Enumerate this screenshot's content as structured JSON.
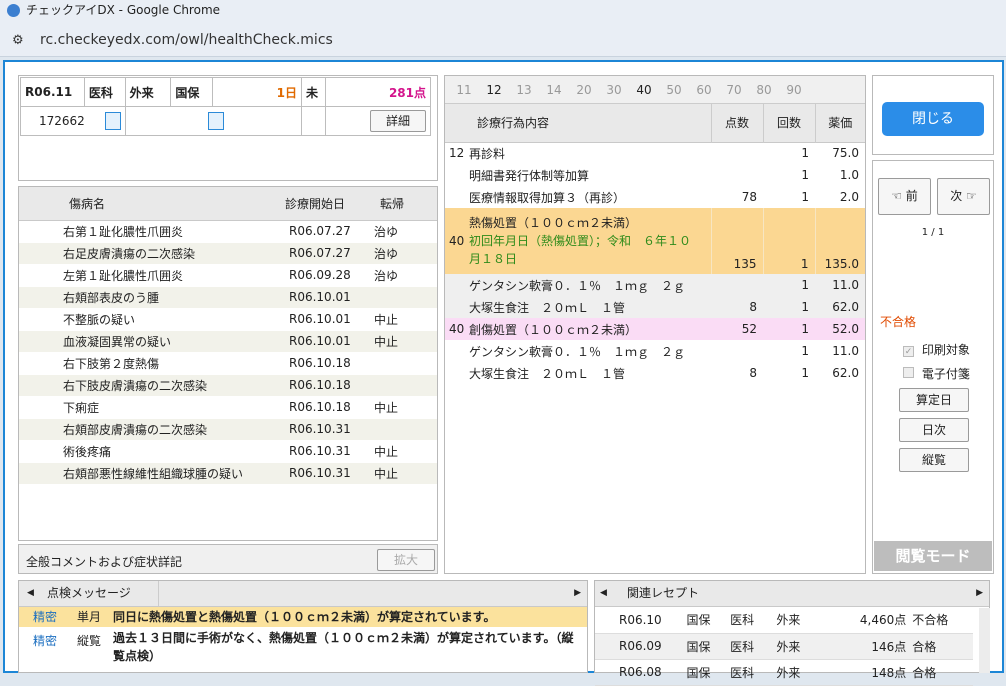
{
  "window": {
    "title": "チェックアイDX - Google Chrome",
    "url": "rc.checkeyedx.com/owl/healthCheck.mics"
  },
  "header": {
    "era": "R06.11",
    "dept": "医科",
    "visit": "外来",
    "ins": "国保",
    "days": "1日",
    "end": "未",
    "points": "281点",
    "patient_id": "172662",
    "detail_btn": "詳細"
  },
  "disease": {
    "col_name": "傷病名",
    "col_start": "診療開始日",
    "col_result": "転帰",
    "rows": [
      {
        "name": "右第１趾化膿性爪囲炎",
        "date": "R06.07.27",
        "result": "治ゆ"
      },
      {
        "name": "右足皮膚潰瘍の二次感染",
        "date": "R06.07.27",
        "result": "治ゆ"
      },
      {
        "name": "左第１趾化膿性爪囲炎",
        "date": "R06.09.28",
        "result": "治ゆ"
      },
      {
        "name": "右頬部表皮のう腫",
        "date": "R06.10.01",
        "result": ""
      },
      {
        "name": "不整脈の疑い",
        "date": "R06.10.01",
        "result": "中止"
      },
      {
        "name": "血液凝固異常の疑い",
        "date": "R06.10.01",
        "result": "中止"
      },
      {
        "name": "右下肢第２度熱傷",
        "date": "R06.10.18",
        "result": ""
      },
      {
        "name": "右下肢皮膚潰瘍の二次感染",
        "date": "R06.10.18",
        "result": ""
      },
      {
        "name": "下痢症",
        "date": "R06.10.18",
        "result": "中止"
      },
      {
        "name": "右頬部皮膚潰瘍の二次感染",
        "date": "R06.10.31",
        "result": ""
      },
      {
        "name": "術後疼痛",
        "date": "R06.10.31",
        "result": "中止"
      },
      {
        "name": "右頬部悪性線維性組織球腫の疑い",
        "date": "R06.10.31",
        "result": "中止"
      }
    ]
  },
  "comment": {
    "label": "全般コメントおよび症状詳記",
    "expand_btn": "拡大"
  },
  "tabs": [
    "11",
    "12",
    "13",
    "14",
    "20",
    "30",
    "40",
    "50",
    "60",
    "70",
    "80",
    "90"
  ],
  "treat": {
    "col_content": "診療行為内容",
    "col_points": "点数",
    "col_count": "回数",
    "col_price": "薬価",
    "rows": [
      {
        "code": "12",
        "content": "再診料",
        "points": "",
        "count": "1",
        "price": "75.0",
        "hl": ""
      },
      {
        "code": "",
        "content": "明細書発行体制等加算",
        "points": "",
        "count": "1",
        "price": "1.0",
        "hl": ""
      },
      {
        "code": "",
        "content": "医療情報取得加算３（再診）",
        "points": "78",
        "count": "1",
        "price": "2.0",
        "hl": ""
      },
      {
        "code": "",
        "content": "ゲンタシン軟膏０．１％　１ｍｇ　２ｇ",
        "points": "",
        "count": "1",
        "price": "11.0",
        "hl": "g"
      },
      {
        "code": "",
        "content": "大塚生食注　２０ｍＬ　１管",
        "points": "8",
        "count": "1",
        "price": "62.0",
        "hl": "g"
      },
      {
        "code": "40",
        "content": "創傷処置（１００ｃｍ２未満）",
        "points": "52",
        "count": "1",
        "price": "52.0",
        "hl": "p"
      },
      {
        "code": "",
        "content": "ゲンタシン軟膏０．１％　１ｍｇ　２ｇ",
        "points": "",
        "count": "1",
        "price": "11.0",
        "hl": ""
      },
      {
        "code": "",
        "content": "大塚生食注　２０ｍＬ　１管",
        "points": "8",
        "count": "1",
        "price": "62.0",
        "hl": ""
      }
    ],
    "burn": {
      "code": "40",
      "line1": "熱傷処置（１００ｃｍ２未満）",
      "line2": "初回年月日（熱傷処置）；令和　６年１０",
      "line3": "月１８日",
      "points": "135",
      "count": "1",
      "price": "135.0"
    }
  },
  "side": {
    "close_btn": "閉じる",
    "prev_btn": "前",
    "next_btn": "次",
    "page": "1 / 1",
    "status": "不合格",
    "print_label": "印刷対象",
    "sticky_label": "電子付箋",
    "calc_btn": "算定日",
    "daily_btn": "日次",
    "vertical_btn": "縦覧",
    "mode": "閲覧モード"
  },
  "messages": {
    "title": "点検メッセージ",
    "rows": [
      {
        "level": "精密",
        "kind": "単月",
        "text": "同日に熱傷処置と熱傷処置（１００ｃｍ２未満）が算定されています。"
      },
      {
        "level": "精密",
        "kind": "縦覧",
        "text": "過去１３日間に手術がなく、熱傷処置（１００ｃｍ２未満）が算定されています。（縦",
        "text2": "覧点検）"
      }
    ]
  },
  "related": {
    "title": "関連レセプト",
    "rows": [
      {
        "m": "R06.10",
        "ins": "国保",
        "dept": "医科",
        "visit": "外来",
        "pts": "4,460点",
        "res": "不合格"
      },
      {
        "m": "R06.09",
        "ins": "国保",
        "dept": "医科",
        "visit": "外来",
        "pts": "146点",
        "res": "合格"
      },
      {
        "m": "R06.08",
        "ins": "国保",
        "dept": "医科",
        "visit": "外来",
        "pts": "148点",
        "res": "合格"
      }
    ]
  }
}
